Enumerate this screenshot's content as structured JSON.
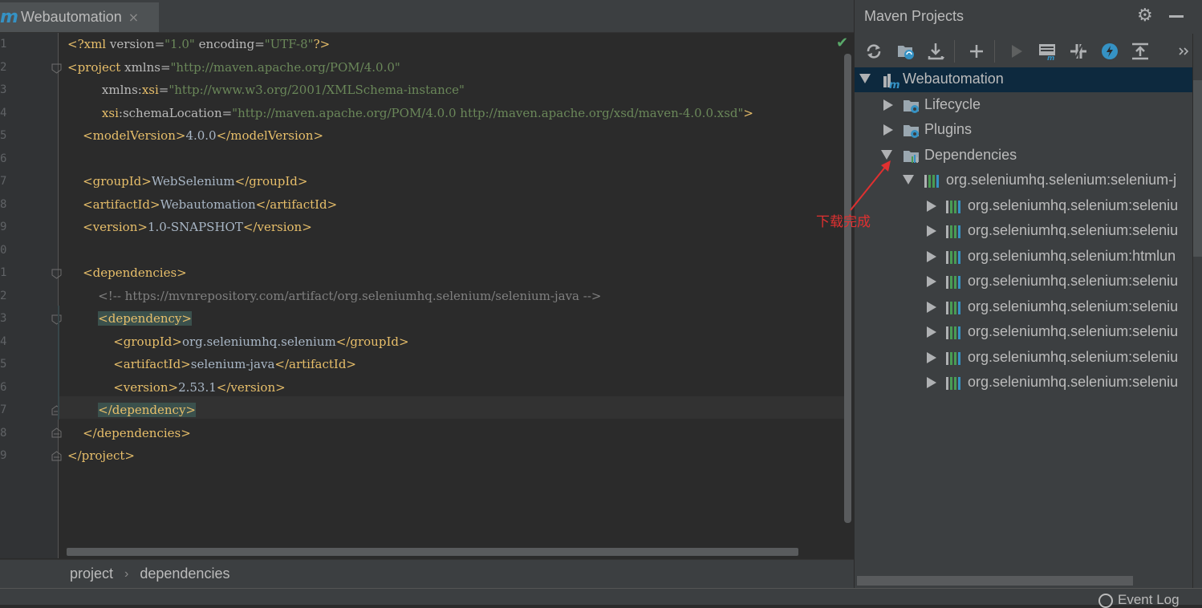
{
  "editor": {
    "tab_label": "Webautomation",
    "tab_close": "×",
    "line_numbers": [
      "1",
      "2",
      "3",
      "4",
      "5",
      "6",
      "7",
      "8",
      "9",
      "0",
      "1",
      "2",
      "3",
      "4",
      "5",
      "6",
      "7",
      "8",
      "9"
    ]
  },
  "breadcrumb": {
    "items": [
      "project",
      "dependencies"
    ],
    "separator": "›"
  },
  "status_bar": {
    "event_log": "Event Log"
  },
  "maven_panel": {
    "title": "Maven Projects",
    "toolbar_icons": [
      "refresh-icon",
      "generate-sources-icon",
      "download-icon",
      "add-icon",
      "run-icon",
      "maven-goal-icon",
      "toggle-offline-icon",
      "skip-tests-icon",
      "collapse-all-icon",
      "more-icon"
    ],
    "tree": {
      "root": "Webautomation",
      "lifecycle": "Lifecycle",
      "plugins": "Plugins",
      "dependencies": "Dependencies",
      "dep_root": "org.seleniumhq.selenium:selenium-j",
      "children": [
        "org.seleniumhq.selenium:seleniu",
        "org.seleniumhq.selenium:seleniu",
        "org.seleniumhq.selenium:htmlun",
        "org.seleniumhq.selenium:seleniu",
        "org.seleniumhq.selenium:seleniu",
        "org.seleniumhq.selenium:seleniu",
        "org.seleniumhq.selenium:seleniu",
        "org.seleniumhq.selenium:seleniu"
      ]
    }
  },
  "annotation": {
    "text": "下载完成",
    "color": "#e03030"
  },
  "colors": {
    "tag": "#e8bf6a",
    "attr_value": "#6a8759",
    "comment": "#808080",
    "text": "#a9b7c6",
    "selection": "#0d293e",
    "accent": "#3592c4"
  }
}
